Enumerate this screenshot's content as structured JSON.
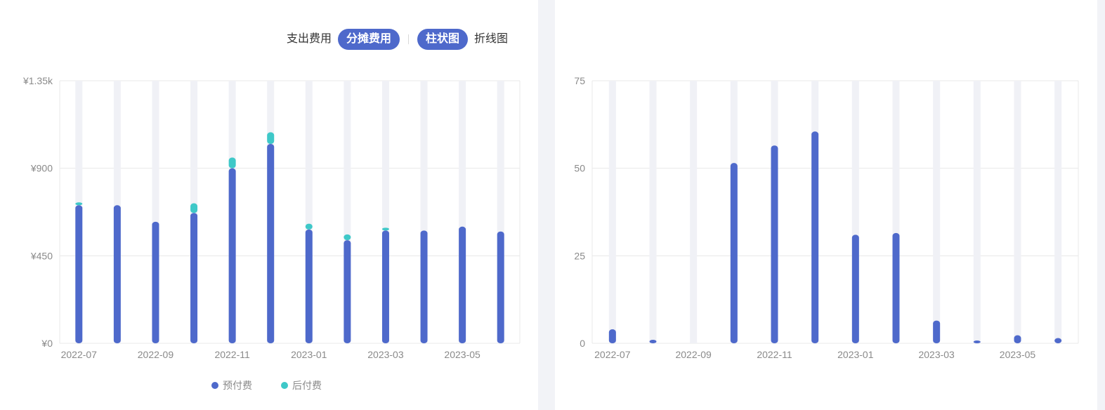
{
  "toolbar": {
    "expense_label": "支出费用",
    "allocated_label": "分摊费用",
    "bar_label": "柱状图",
    "line_label": "折线图"
  },
  "colors": {
    "prepaid": "#4e69cb",
    "postpaid": "#3ec8c8",
    "track": "#f0f1f6",
    "grid": "#e8e8e8",
    "active": "#4e69cb"
  },
  "chart_data": [
    {
      "type": "bar",
      "stacked": true,
      "title": "",
      "xlabel": "",
      "ylabel": "",
      "categories": [
        "2022-07",
        "2022-08",
        "2022-09",
        "2022-10",
        "2022-11",
        "2022-12",
        "2023-01",
        "2023-02",
        "2023-03",
        "2023-04",
        "2023-05",
        "2023-06"
      ],
      "x_tick_labels": [
        "2022-07",
        "2022-09",
        "2022-11",
        "2023-01",
        "2023-03",
        "2023-05"
      ],
      "y_tick_labels": [
        "¥0",
        "¥450",
        "¥900",
        "¥1.35k"
      ],
      "ylim": [
        0,
        1350
      ],
      "grid": true,
      "legend": "bottom-center",
      "series": [
        {
          "name": "预付费",
          "color": "#4e69cb",
          "values": [
            710,
            710,
            625,
            670,
            900,
            1025,
            585,
            530,
            580,
            580,
            600,
            575
          ]
        },
        {
          "name": "后付费",
          "color": "#3ec8c8",
          "values": [
            5,
            0,
            0,
            50,
            55,
            60,
            30,
            30,
            10,
            0,
            0,
            0
          ]
        }
      ]
    },
    {
      "type": "bar",
      "title": "",
      "xlabel": "",
      "ylabel": "",
      "categories": [
        "2022-07",
        "2022-08",
        "2022-09",
        "2022-10",
        "2022-11",
        "2022-12",
        "2023-01",
        "2023-02",
        "2023-03",
        "2023-04",
        "2023-05",
        "2023-06"
      ],
      "x_tick_labels": [
        "2022-07",
        "2022-09",
        "2022-11",
        "2023-01",
        "2023-03",
        "2023-05"
      ],
      "y_tick_labels": [
        "0",
        "25",
        "50",
        "75"
      ],
      "ylim": [
        0,
        75
      ],
      "grid": true,
      "series": [
        {
          "color": "#4e69cb",
          "values": [
            4,
            1,
            0,
            51.5,
            56.5,
            60.5,
            31,
            31.5,
            6.5,
            0.8,
            2.3,
            1.5
          ]
        }
      ]
    }
  ]
}
